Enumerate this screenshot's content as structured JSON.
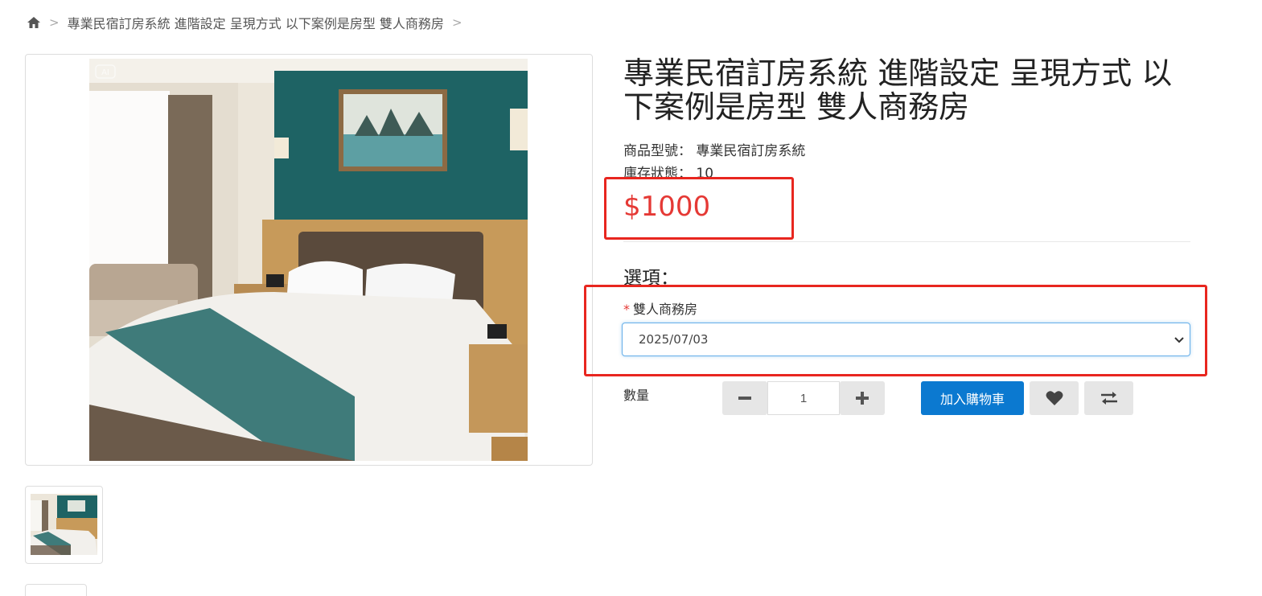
{
  "breadcrumb": {
    "home_icon": "home-icon",
    "items": [
      "專業民宿訂房系統 進階設定 呈現方式 以下案例是房型 雙人商務房"
    ]
  },
  "product": {
    "title": "專業民宿訂房系統 進階設定 呈現方式 以下案例是房型 雙人商務房",
    "model_label": "商品型號：",
    "model_value": "專業民宿訂房系統",
    "stock_label": "庫存狀態：",
    "stock_value": "10",
    "price": "$1000",
    "image_badge": "AI"
  },
  "options": {
    "title": "選項：",
    "field_label": "雙人商務房",
    "required_mark": "*",
    "selected_value": "2025/07/03"
  },
  "purchase": {
    "quantity_label": "數量",
    "quantity_value": "1",
    "add_to_cart_label": "加入購物車",
    "wishlist_icon": "heart-icon",
    "compare_icon": "compare-arrows-icon"
  },
  "colors": {
    "price": "#e53935",
    "primary_button": "#0b79d0",
    "annotation": "#e8261f"
  }
}
